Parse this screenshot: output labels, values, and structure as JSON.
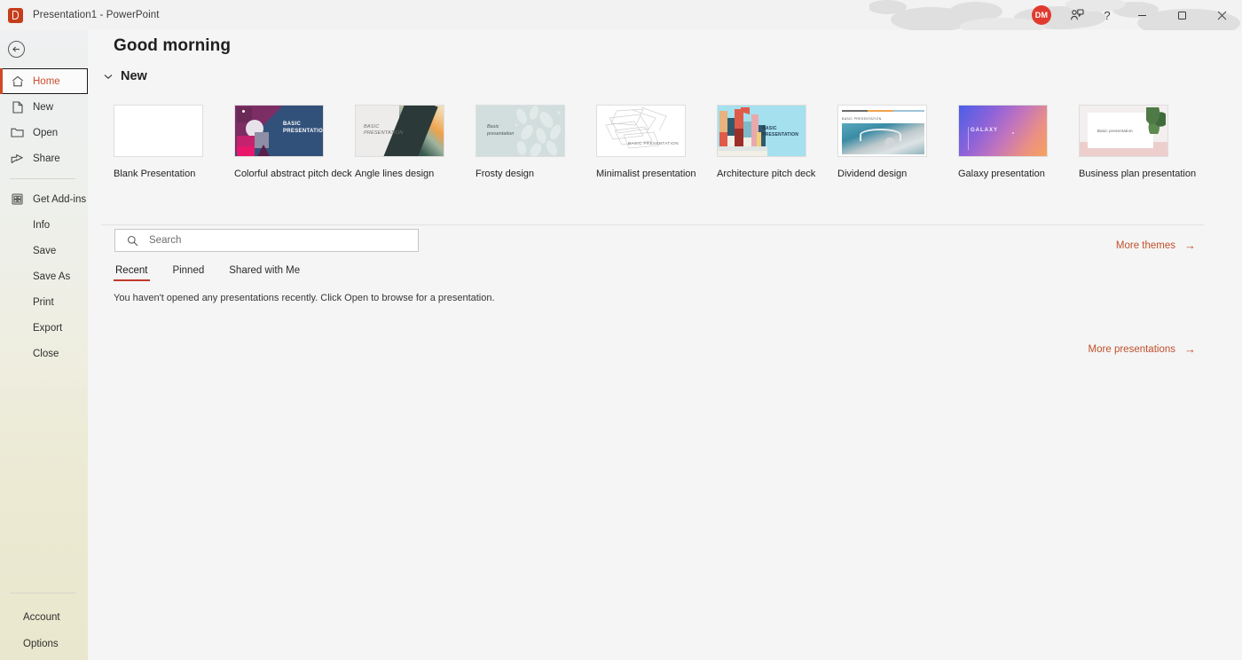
{
  "titlebar": {
    "app_icon": "powerpoint-logo-icon",
    "title": "Presentation1  -  PowerPoint",
    "avatar_initials": "DM",
    "share_icon": "share-person-icon",
    "help_glyph": "?",
    "minimize_glyph": "‒",
    "maximize_glyph": "☐",
    "close_glyph": "✕"
  },
  "sidebar": {
    "back_glyph": "←",
    "items": [
      {
        "label": "Home",
        "icon": "home-icon",
        "selected": true
      },
      {
        "label": "New",
        "icon": "new-document-icon",
        "selected": false
      },
      {
        "label": "Open",
        "icon": "folder-open-icon",
        "selected": false
      },
      {
        "label": "Share",
        "icon": "share-icon",
        "selected": false
      }
    ],
    "items2": [
      {
        "label": "Get Add-ins",
        "icon": "addins-grid-icon"
      },
      {
        "label": "Info",
        "icon": ""
      },
      {
        "label": "Save",
        "icon": ""
      },
      {
        "label": "Save As",
        "icon": ""
      },
      {
        "label": "Print",
        "icon": ""
      },
      {
        "label": "Export",
        "icon": ""
      },
      {
        "label": "Close",
        "icon": ""
      }
    ],
    "bottom_items": [
      {
        "label": "Account"
      },
      {
        "label": "Options"
      }
    ]
  },
  "main": {
    "greeting": "Good morning",
    "new_section": {
      "title": "New",
      "collapse_icon": "chevron-down-icon"
    },
    "templates": [
      {
        "label": "Blank Presentation",
        "art": "blank",
        "title_text": ""
      },
      {
        "label": "Colorful abstract pitch deck",
        "art": "colorful",
        "title_text": "BASIC\nPRESENTATION"
      },
      {
        "label": "Angle lines design",
        "art": "angle",
        "title_text": "BASIC\nPRESENTATION"
      },
      {
        "label": "Frosty design",
        "art": "frosty",
        "title_text": "Basic\npresentation"
      },
      {
        "label": "Minimalist presentation",
        "art": "minimal",
        "title_text": "BASIC PRESENTATION"
      },
      {
        "label": "Architecture pitch deck",
        "art": "arch",
        "title_text": "BASIC\nPRESENTATION"
      },
      {
        "label": "Dividend design",
        "art": "dividend",
        "title_text": "BASIC PRESENTATION"
      },
      {
        "label": "Galaxy presentation",
        "art": "galaxy",
        "title_text": "GALAXY"
      },
      {
        "label": "Business plan presentation",
        "art": "bizplan",
        "title_text": "Basic presentation"
      }
    ],
    "more_themes": {
      "label": "More themes",
      "arrow": "→"
    },
    "search": {
      "placeholder": "Search",
      "value": "",
      "icon": "search-icon"
    },
    "tabs": [
      {
        "label": "Recent",
        "active": true
      },
      {
        "label": "Pinned",
        "active": false
      },
      {
        "label": "Shared with Me",
        "active": false
      }
    ],
    "empty_message": "You haven't opened any presentations recently. Click Open to browse for a presentation.",
    "more_presentations": {
      "label": "More presentations",
      "arrow": "→"
    }
  },
  "colors": {
    "accent_red": "#c0392b",
    "link_orange": "#c0502c",
    "brand_powerpoint": "#c43e1c",
    "avatar_red": "#e03a2f",
    "sidebar_bottom": "#e9e7cd",
    "content_bg": "#f5f5f5"
  }
}
